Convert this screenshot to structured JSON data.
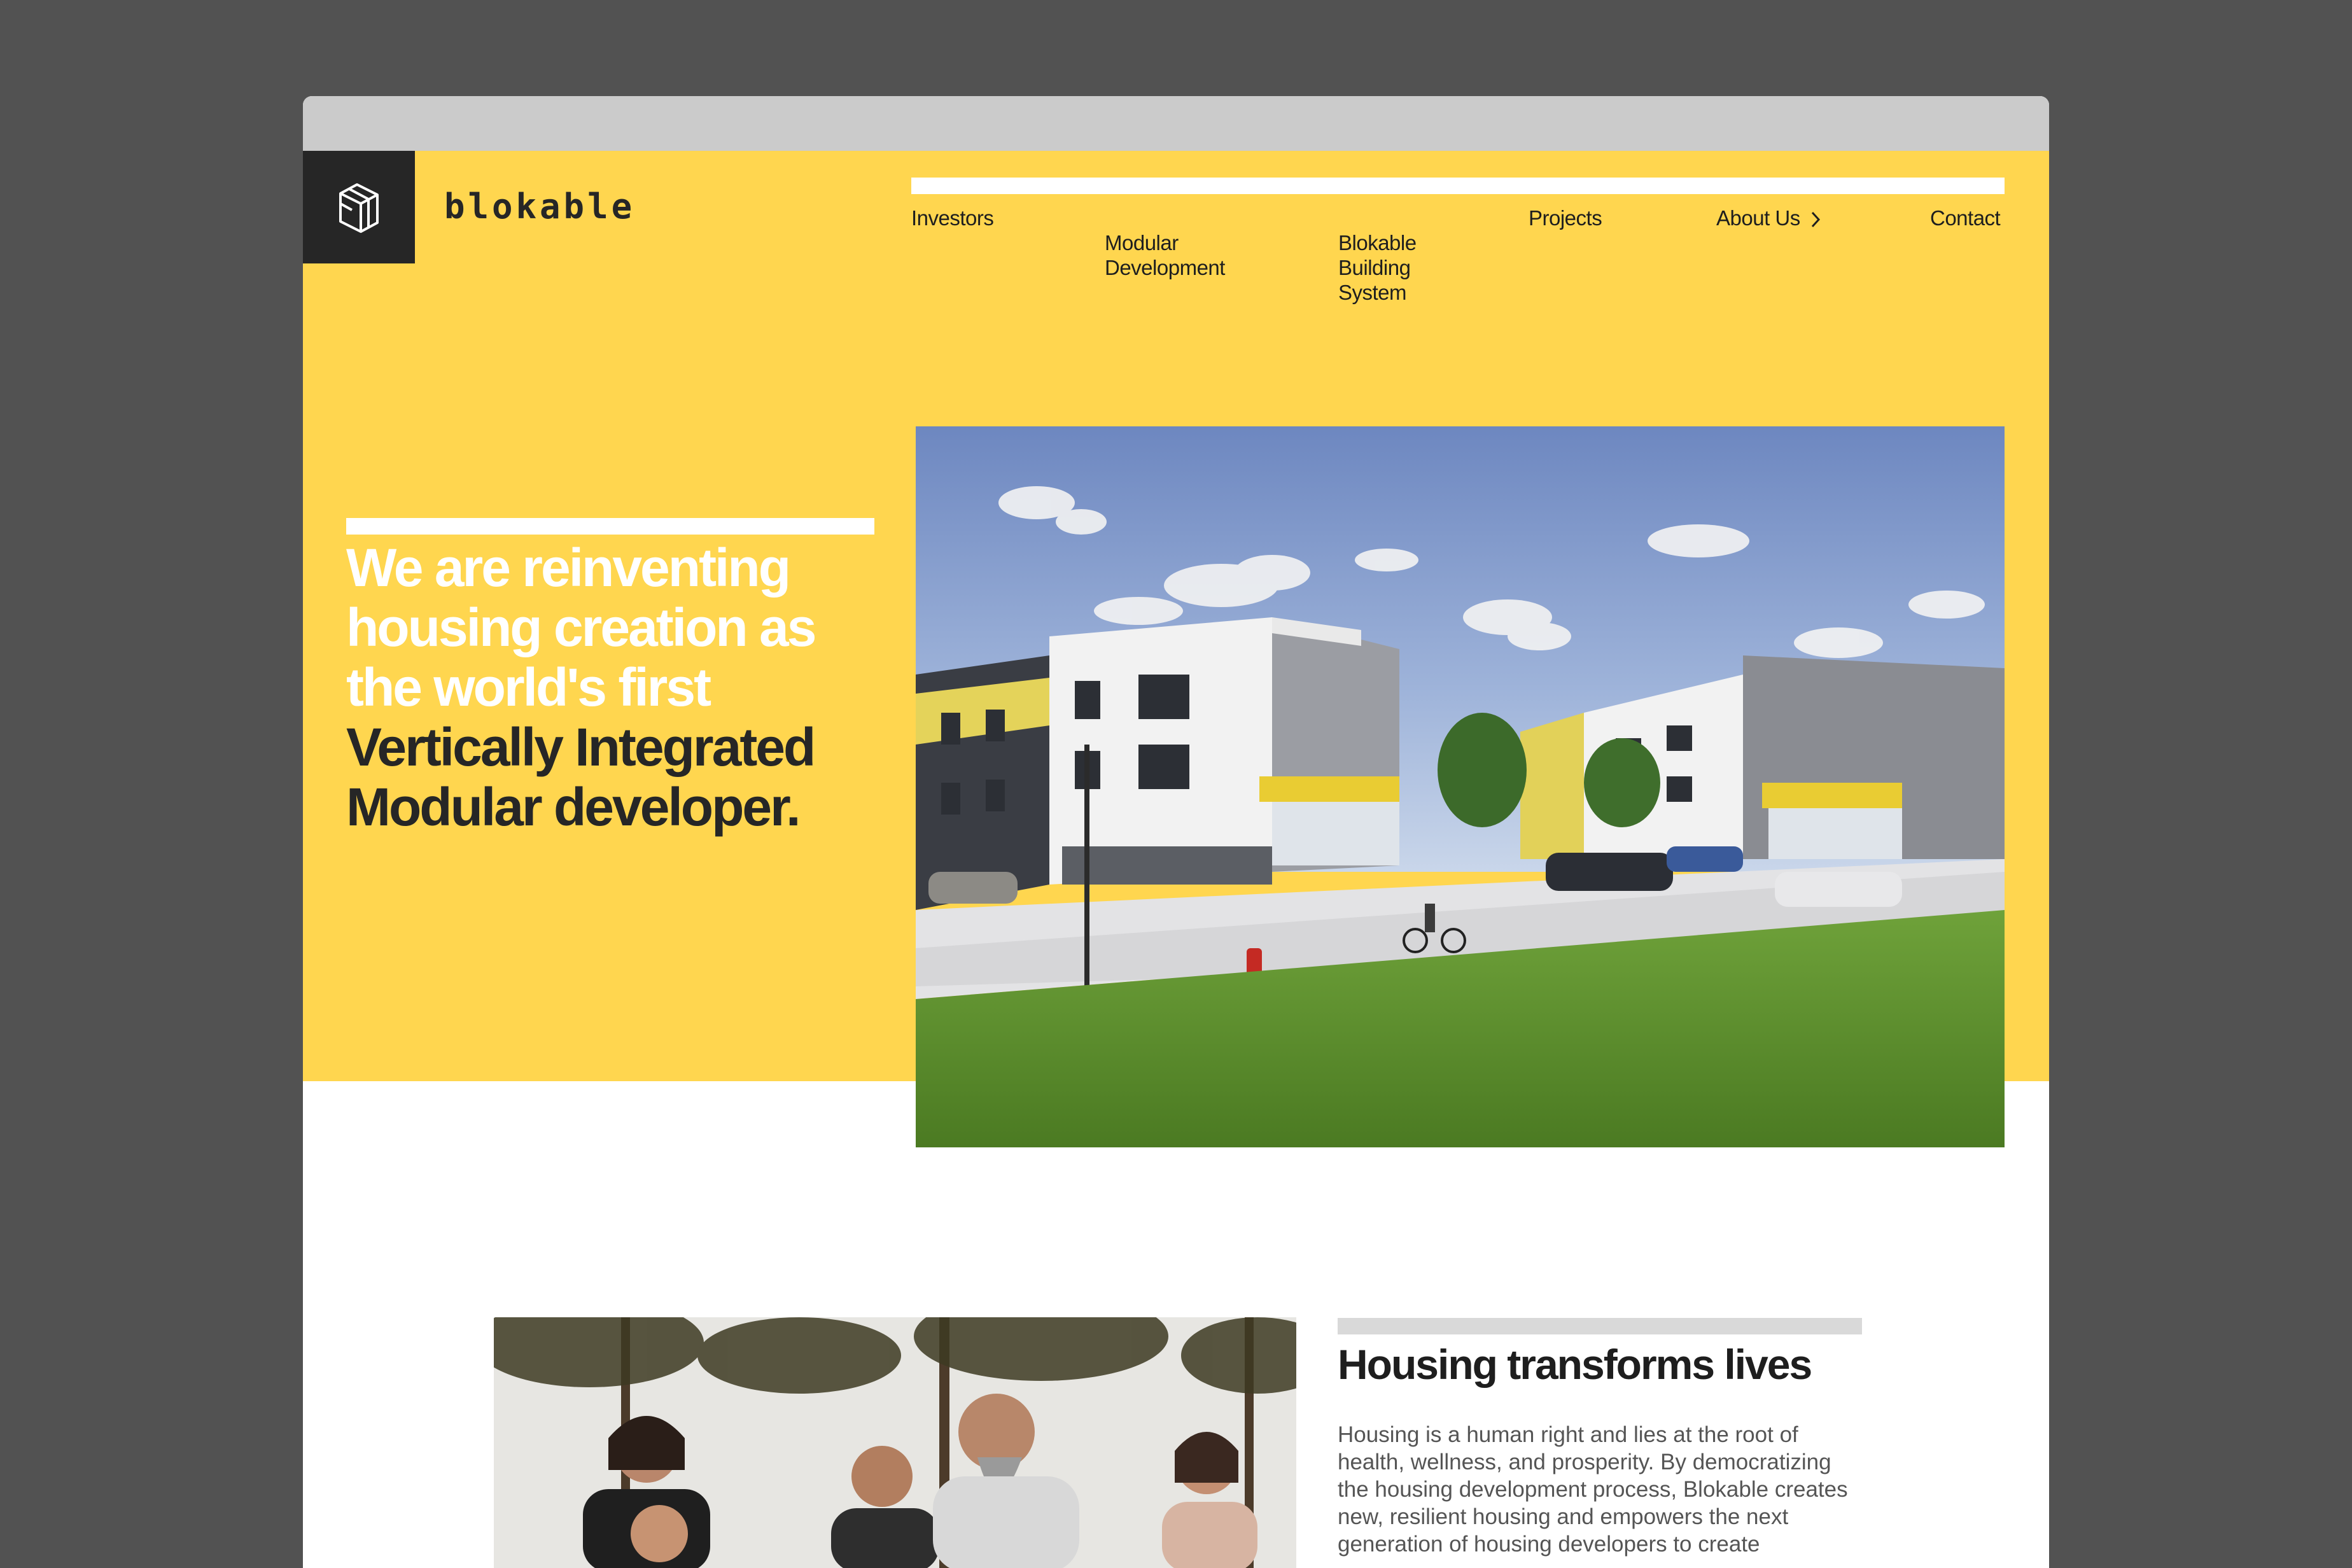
{
  "brand": {
    "name": "blokable",
    "colors": {
      "yellow": "#ffd64f",
      "dark": "#262626",
      "chrome": "#cbcbcb",
      "background": "#525252"
    },
    "logo_icon": "cube-outline-icon"
  },
  "nav": {
    "items": [
      {
        "id": "investors",
        "label": "Investors"
      },
      {
        "id": "modular-development",
        "label": "Modular\nDevelopment"
      },
      {
        "id": "blokable-building-system",
        "label": "Blokable\nBuilding\nSystem"
      },
      {
        "id": "projects",
        "label": "Projects"
      },
      {
        "id": "about-us",
        "label": "About Us",
        "icon": "chevron-right-icon"
      },
      {
        "id": "contact",
        "label": "Contact"
      }
    ]
  },
  "hero": {
    "title_light": "We are reinventing housing creation as the world's first",
    "title_dark": "Vertically Integrated Modular developer.",
    "image_icon": "apartment-rendering-image"
  },
  "section": {
    "title": "Housing transforms lives",
    "body": "Housing is a human right and lies at the root of health, wellness, and prosperity. By democratizing the housing development process, Blokable creates new, resilient housing and empowers the next generation of housing developers to create",
    "image_icon": "people-community-photo"
  }
}
